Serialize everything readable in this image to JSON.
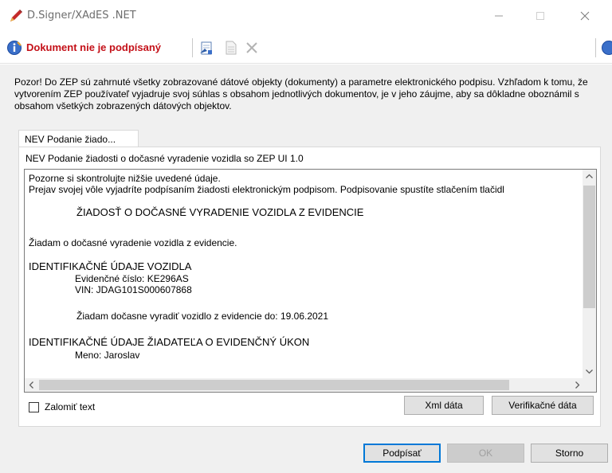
{
  "window": {
    "title": "D.Signer/XAdES .NET",
    "icons": [
      "pen-icon",
      "minimize-icon",
      "maximize-icon",
      "close-icon"
    ]
  },
  "toolbar": {
    "status": "Dokument nie je podpísaný",
    "status_color": "#c41018",
    "icons": [
      "info-icon",
      "sign-document-icon",
      "document-icon",
      "delete-icon",
      "help-icon"
    ]
  },
  "warning": "Pozor! Do ZEP sú zahrnuté všetky zobrazované dátové objekty (dokumenty) a parametre elektronického podpisu. Vzhľadom k tomu, že vytvorením ZEP používateľ vyjadruje svoj súhlas s obsahom jednotlivých dokumentov, je v jeho záujme, aby sa dôkladne oboznámil s obsahom všetkých zobrazených dátových objektov.",
  "tab": {
    "label": "NEV Podanie žiado...",
    "doc_title": "NEV Podanie žiadosti o dočasné vyradenie vozidla so ZEP UI 1.0"
  },
  "content": {
    "line1": "Pozorne si skontrolujte nižšie uvedené údaje.",
    "line2": "Prejav svojej vôle vyjadríte podpísaním žiadosti elektronickým podpisom. Podpisovanie spustíte stlačením tlačidl",
    "heading": "ŽIADOSŤ O DOČASNÉ VYRADENIE VOZIDLA Z EVIDENCIE",
    "request": "Žiadam o dočasné vyradenie vozidla z evidencie.",
    "vehicle_section": "IDENTIFIKAČNÉ ÚDAJE VOZIDLA",
    "plate": "Evidenčné číslo: KE296AS",
    "vin": "VIN: JDAG101S000607868",
    "until": "Žiadam dočasne vyradiť vozidlo z evidencie do: 19.06.2021",
    "applicant_section": "IDENTIFIKAČNÉ ÚDAJE ŽIADATEĽA O EVIDENČNÝ ÚKON",
    "name": "Meno: Jaroslav"
  },
  "controls": {
    "wrap_label": "Zalomiť text",
    "wrap_checked": false,
    "xml_button": "Xml dáta",
    "verif_button": "Verifikačné dáta",
    "sign_button": "Podpísať",
    "ok_button": "OK",
    "cancel_button": "Storno"
  }
}
